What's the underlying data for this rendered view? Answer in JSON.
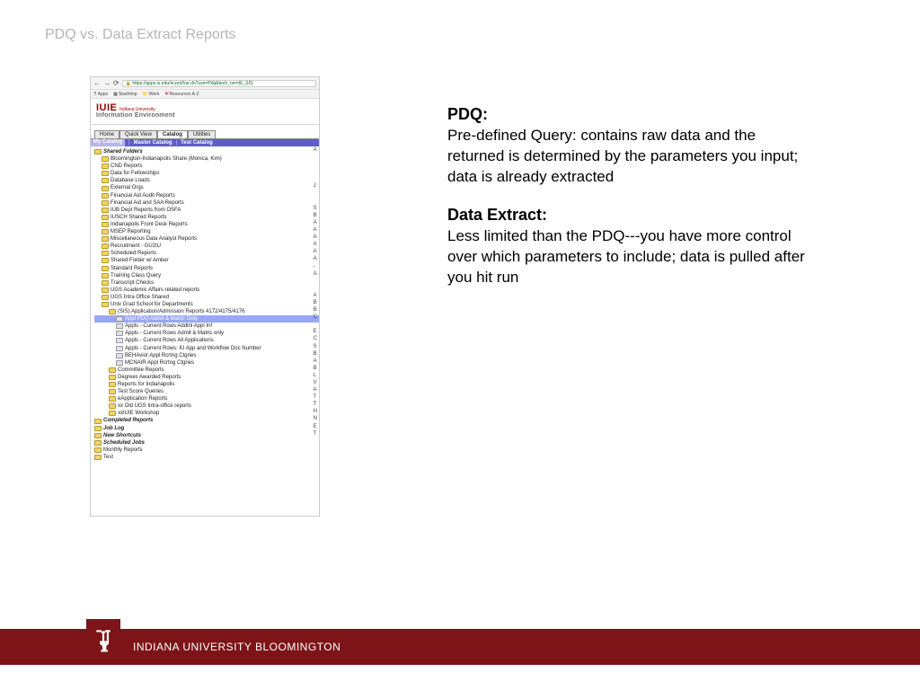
{
  "slide": {
    "title": "PDQ vs. Data Extract Reports"
  },
  "browser": {
    "url": "https://apps.iu.edu/ie-prd/Iue.do?use=Pdq&tech_nm=IE_SIS",
    "bookmarks": [
      "Apps",
      "Slashtmp",
      "Work",
      "Resources A-Z"
    ]
  },
  "iuie": {
    "logo": "IUIE",
    "sub": "Indiana University",
    "line2": "Information Environment",
    "tabs": [
      "Home",
      "Quick View",
      "Catalog",
      "Utilities"
    ],
    "active_tab": 2,
    "subtabs": [
      "My Catalog",
      "Master Catalog",
      "Test Catalog"
    ]
  },
  "tree": {
    "shared_folders": "Shared Folders",
    "items": [
      "Bloomington-Indianapolis Share (Monica, Kim)",
      "CND Reports",
      "Data for Fellowships",
      "Database Loads",
      "External Orgs",
      "Financial Aid Audit Reports",
      "Financial Aid and SAA Reports",
      "IUB Dept Reports from OSFA",
      "IUSCH Shared Reports",
      "Indianapolis Front Desk Reports",
      "MSEP Reporting",
      "Miscellaneous Data Analyst Reports",
      "Recruitment - GU2IU",
      "Scheduled Reports",
      "Shared Folder w/ Amber",
      "Standard Reports",
      "Training Class Query",
      "Transcript Checks",
      "UGS Academic Affairs related reports",
      "UGS Intra Office Shared",
      "Univ Grad School for Departments"
    ],
    "expanded_sub": "(SIS) Application/Admission Reports 4172/4175/4176",
    "leaves": [
      "Appl PDQ Admit & Matric Only",
      "Appls - Current Rows Addtnl Appl Inf",
      "Appls - Current Rows Admit & Matric only",
      "Appls - Current Rows All Applications",
      "Appls - Current Rows: IU App and Workflow Doc Number",
      "BEHAvior Appl Rcrtng Ctgries",
      "MCNAIR Appl Rcrtng Ctgries"
    ],
    "more_items": [
      "Committee Reports",
      "Degrees Awarded Reports",
      "Reports for Indianapolis",
      "Test Score Queries",
      "eApplication Reports",
      "xx Old UGS Intra-office reports",
      "xxIUIE Workshop"
    ],
    "root_items": [
      "Completed Reports",
      "Job Log",
      "New Shortcuts",
      "Scheduled Jobs",
      "Monthly Reports",
      "Test"
    ]
  },
  "alpha": [
    "A",
    "",
    "",
    "",
    "",
    "J",
    "",
    "",
    "S",
    "B",
    "A",
    "A",
    "A",
    "A",
    "A",
    "A",
    "-",
    "A",
    "",
    "",
    "A",
    "B",
    "B",
    "C",
    "",
    "E",
    "C",
    "S",
    "B",
    "A",
    "B",
    "L",
    "V",
    "A",
    "T",
    "T",
    "H",
    "N",
    "E",
    "T"
  ],
  "content": {
    "pdq_heading": "PDQ:",
    "pdq_body": "Pre-defined Query: contains raw data and the returned is determined by the parameters you input; data is already extracted",
    "de_heading": "Data Extract:",
    "de_body": "Less limited than the PDQ---you have more control over which parameters to include; data is pulled after you hit run"
  },
  "footer": {
    "text": "INDIANA UNIVERSITY BLOOMINGTON"
  }
}
